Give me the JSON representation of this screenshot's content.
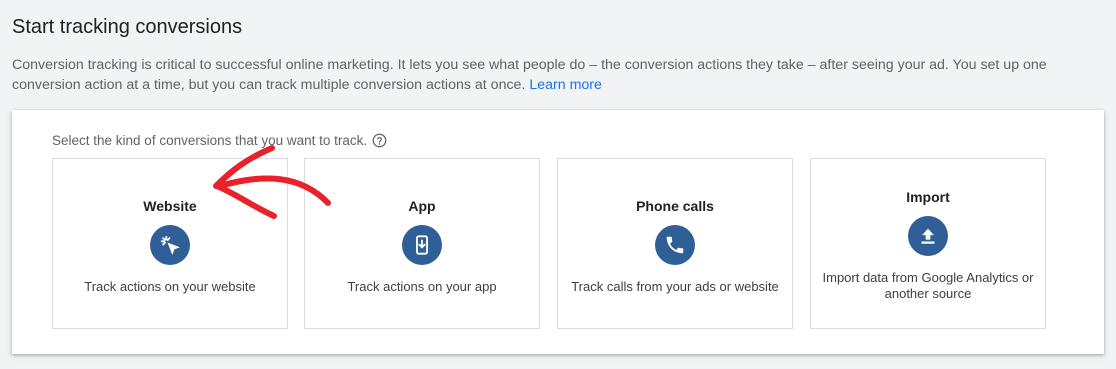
{
  "header": {
    "title": "Start tracking conversions",
    "description": "Conversion tracking is critical to successful online marketing. It lets you see what people do – the conversion actions they take – after seeing your ad. You set up one conversion action at a time, but you can track multiple conversion actions at once.",
    "learn_more": "Learn more"
  },
  "panel": {
    "prompt": "Select the kind of conversions that you want to track.",
    "cards": [
      {
        "title": "Website",
        "description": "Track actions on your website",
        "icon": "cursor-click-icon"
      },
      {
        "title": "App",
        "description": "Track actions on your app",
        "icon": "phone-download-icon"
      },
      {
        "title": "Phone calls",
        "description": "Track calls from your ads or website",
        "icon": "phone-icon"
      },
      {
        "title": "Import",
        "description": "Import data from Google Analytics or another source",
        "icon": "upload-icon"
      }
    ]
  },
  "colors": {
    "icon_bg": "#2f5f96",
    "link": "#1a73e8",
    "annotation": "#e8212b"
  }
}
